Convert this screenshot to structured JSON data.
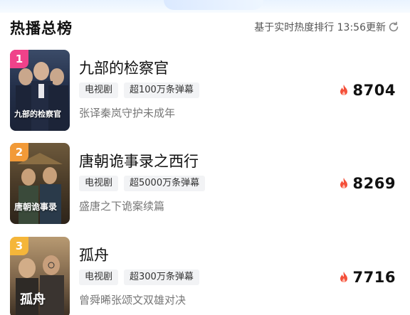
{
  "header": {
    "title": "热播总榜",
    "update_text": "基于实时热度排行 13:56更新"
  },
  "items": [
    {
      "rank": "1",
      "rank_color": "#f0428a",
      "poster_text": "九部的检察官",
      "title": "九部的检察官",
      "tags": [
        "电视剧",
        "超100万条弹幕"
      ],
      "subtitle": "张译秦岚守护未成年",
      "heat": "8704"
    },
    {
      "rank": "2",
      "rank_color": "#f29a38",
      "poster_text": "唐朝诡事录",
      "title": "唐朝诡事录之西行",
      "tags": [
        "电视剧",
        "超5000万条弹幕"
      ],
      "subtitle": "盛唐之下诡案续篇",
      "heat": "8269"
    },
    {
      "rank": "3",
      "rank_color": "#f5b63a",
      "poster_text": "孤舟",
      "title": "孤舟",
      "tags": [
        "电视剧",
        "超300万条弹幕"
      ],
      "subtitle": "曾舜晞张颂文双雄对决",
      "heat": "7716"
    }
  ],
  "colors": {
    "fire": "#f4503a",
    "tag_bg": "#f2f3f5"
  },
  "icons": {
    "refresh": "refresh-icon",
    "heat": "fire-icon"
  }
}
